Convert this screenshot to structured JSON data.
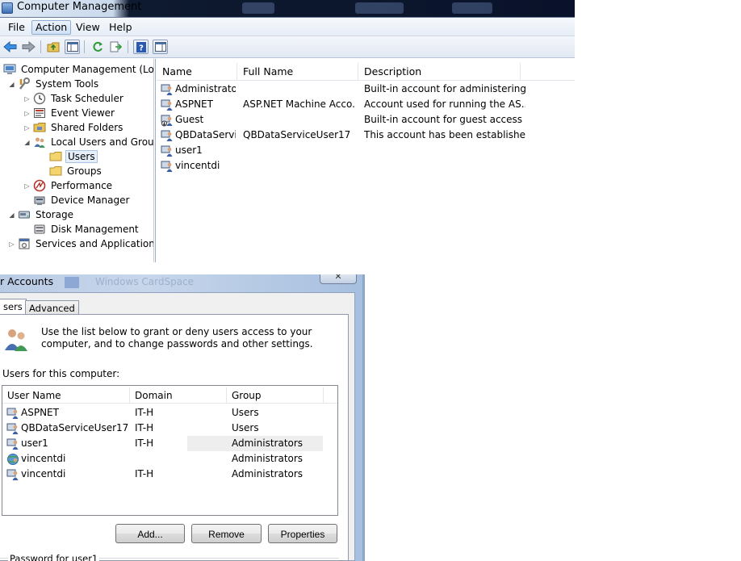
{
  "computer_management": {
    "title": "Computer Management",
    "menus": [
      "File",
      "Action",
      "View",
      "Help"
    ],
    "active_menu": "Action",
    "tree": [
      {
        "label": "Computer Management (Local",
        "icon": "computer-management-icon",
        "expander": "",
        "level": 0
      },
      {
        "label": "System Tools",
        "icon": "system-tools-icon",
        "expander": "expanded",
        "level": 1
      },
      {
        "label": "Task Scheduler",
        "icon": "task-scheduler-icon",
        "expander": "collapsed",
        "level": 2
      },
      {
        "label": "Event Viewer",
        "icon": "event-viewer-icon",
        "expander": "collapsed",
        "level": 2
      },
      {
        "label": "Shared Folders",
        "icon": "shared-folders-icon",
        "expander": "collapsed",
        "level": 2
      },
      {
        "label": "Local Users and Groups",
        "icon": "local-users-groups-icon",
        "expander": "expanded",
        "level": 2
      },
      {
        "label": "Users",
        "icon": "folder-icon",
        "expander": "",
        "level": 3,
        "selected": true
      },
      {
        "label": "Groups",
        "icon": "folder-icon",
        "expander": "",
        "level": 3
      },
      {
        "label": "Performance",
        "icon": "performance-icon",
        "expander": "collapsed",
        "level": 2
      },
      {
        "label": "Device Manager",
        "icon": "device-manager-icon",
        "expander": "",
        "level": 2
      },
      {
        "label": "Storage",
        "icon": "storage-icon",
        "expander": "expanded",
        "level": 1
      },
      {
        "label": "Disk Management",
        "icon": "disk-management-icon",
        "expander": "",
        "level": 2
      },
      {
        "label": "Services and Applications",
        "icon": "services-applications-icon",
        "expander": "collapsed",
        "level": 1
      }
    ],
    "columns": [
      "Name",
      "Full Name",
      "Description"
    ],
    "users": [
      {
        "name": "Administrator",
        "full_name": "",
        "description": "Built-in account for administering...",
        "disabled": false
      },
      {
        "name": "ASPNET",
        "full_name": "ASP.NET Machine Acco...",
        "description": "Account used for running the AS...",
        "disabled": false
      },
      {
        "name": "Guest",
        "full_name": "",
        "description": "Built-in account for guest access t...",
        "disabled": true
      },
      {
        "name": "QBDataServi...",
        "full_name": "QBDataServiceUser17",
        "description": "This account has been establishe...",
        "disabled": false
      },
      {
        "name": "user1",
        "full_name": "",
        "description": "",
        "disabled": false
      },
      {
        "name": "vincentdi",
        "full_name": "",
        "description": "",
        "disabled": false
      }
    ]
  },
  "user_accounts": {
    "title": "r Accounts",
    "ghost_title": "Windows CardSpace",
    "close_label": "✕",
    "tabs": [
      "sers",
      "Advanced"
    ],
    "intro": "Use the list below to grant or deny users access to your computer, and to change passwords and other settings.",
    "caption": "Users for this computer:",
    "columns": [
      "User Name",
      "Domain",
      "Group"
    ],
    "rows": [
      {
        "user": "ASPNET",
        "domain": "IT-H",
        "group": "Users"
      },
      {
        "user": "QBDataServiceUser17",
        "domain": "IT-H",
        "group": "Users"
      },
      {
        "user": "user1",
        "domain": "IT-H",
        "group": "Administrators",
        "selected": true
      },
      {
        "user": "vincentdi",
        "domain": "",
        "group": "Administrators"
      },
      {
        "user": "vincentdi",
        "domain": "IT-H",
        "group": "Administrators"
      }
    ],
    "buttons": {
      "add": "Add...",
      "remove": "Remove",
      "properties": "Properties"
    },
    "password_group": "Password for user1"
  },
  "colors": {
    "accent": "#3d6fb6",
    "selection": "#e5eef9",
    "selection_border": "#a8c3e4"
  }
}
